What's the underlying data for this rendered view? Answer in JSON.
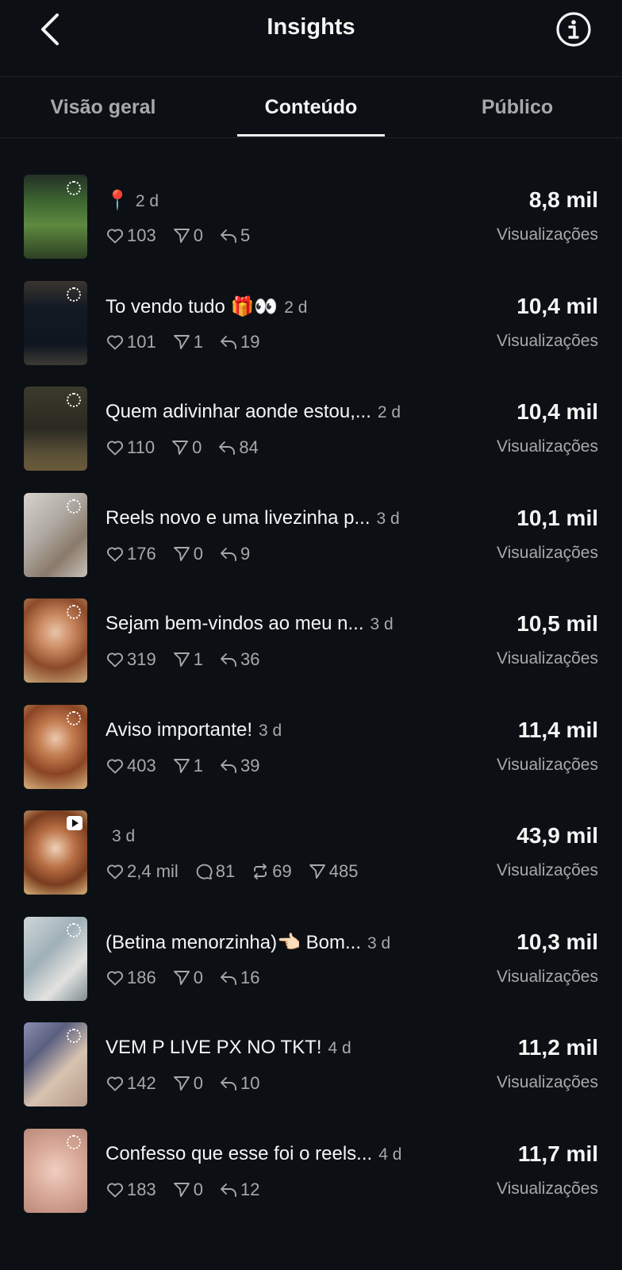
{
  "header": {
    "title": "Insights"
  },
  "tabs": [
    {
      "label": "Visão geral",
      "active": false
    },
    {
      "label": "Conteúdo",
      "active": true
    },
    {
      "label": "Público",
      "active": false
    }
  ],
  "views_label": "Visualizações",
  "posts": [
    {
      "caption": "📍",
      "age": "2 d",
      "likes": "103",
      "shares": "0",
      "replies": "5",
      "views": "8,8 mil",
      "type": "story"
    },
    {
      "caption": "To vendo tudo 🎁👀",
      "age": "2 d",
      "likes": "101",
      "shares": "1",
      "replies": "19",
      "views": "10,4 mil",
      "type": "story"
    },
    {
      "caption": "Quem adivinhar aonde estou,...",
      "age": "2 d",
      "likes": "110",
      "shares": "0",
      "replies": "84",
      "views": "10,4 mil",
      "type": "story"
    },
    {
      "caption": "Reels novo e uma livezinha p...",
      "age": "3 d",
      "likes": "176",
      "shares": "0",
      "replies": "9",
      "views": "10,1 mil",
      "type": "story"
    },
    {
      "caption": "Sejam bem-vindos ao meu n...",
      "age": "3 d",
      "likes": "319",
      "shares": "1",
      "replies": "36",
      "views": "10,5 mil",
      "type": "story"
    },
    {
      "caption": "Aviso importante!",
      "age": "3 d",
      "likes": "403",
      "shares": "1",
      "replies": "39",
      "views": "11,4 mil",
      "type": "story"
    },
    {
      "caption": "",
      "age": "3 d",
      "likes": "2,4 mil",
      "comments": "81",
      "reposts": "69",
      "shares": "485",
      "views": "43,9 mil",
      "type": "reel"
    },
    {
      "caption": "(Betina menorzinha)👈🏻 Bom...",
      "age": "3 d",
      "likes": "186",
      "shares": "0",
      "replies": "16",
      "views": "10,3 mil",
      "type": "story"
    },
    {
      "caption": "VEM P LIVE PX NO TKT!",
      "age": "4 d",
      "likes": "142",
      "shares": "0",
      "replies": "10",
      "views": "11,2 mil",
      "type": "story"
    },
    {
      "caption": "Confesso que esse foi o reels...",
      "age": "4 d",
      "likes": "183",
      "shares": "0",
      "replies": "12",
      "views": "11,7 mil",
      "type": "story"
    }
  ]
}
